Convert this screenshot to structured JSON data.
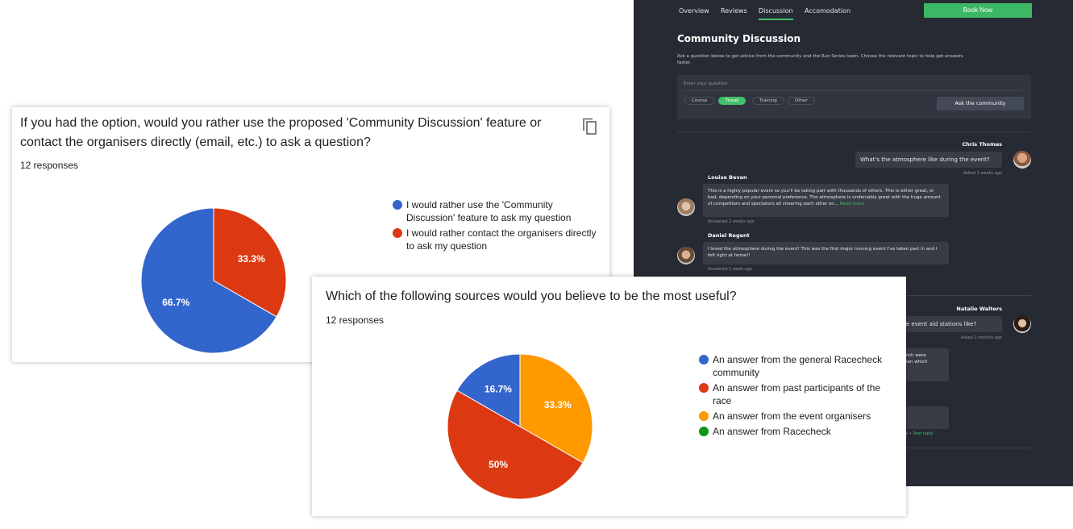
{
  "app": {
    "nav": {
      "tabs": [
        {
          "label": "Overview"
        },
        {
          "label": "Reviews"
        },
        {
          "label": "Discussion"
        },
        {
          "label": "Accomodation"
        }
      ],
      "book_label": "Book Now"
    },
    "title": "Community Discussion",
    "description": "Ask a question below to get advice from the community and the Run Series team. Choose the relevant topic to help get answers faster.",
    "ask": {
      "placeholder": "Enter your question",
      "topics": [
        "Course",
        "Travel",
        "Training",
        "Other"
      ],
      "active_topic": "Travel",
      "button_label": "Ask the community"
    },
    "threads": [
      {
        "asker": "Chris Thomas",
        "question": "What's the atmosphere like during the event?",
        "asked": "Asked 3 weeks ago",
        "answers": [
          {
            "name": "Louise Bevan",
            "text": "This is a highly popular event so you'll be taking part with thousands of others. This is either great, or bad, depending on your personal preference. The atmosphere is undeniably great with the huge amount of competitors and spectators all cheering each other on...",
            "read_more": "Read more",
            "meta": "Answered 2 weeks ago"
          },
          {
            "name": "Daniel Regent",
            "text": "I loved the atmosphere during the event! This was the first major running event I've taken part in and I felt right at home!!",
            "meta": "Answered 1 week ago"
          }
        ]
      },
      {
        "asker": "Natalie Walters",
        "question": "vere the event aid stations like?",
        "asked": "Asked 2 months ago",
        "answer_fragment": "hich were\ntion which",
        "footer_fragment": "el",
        "post_reply": "Post reply"
      }
    ]
  },
  "colors": {
    "blue": "#3366cc",
    "red": "#dc3912",
    "orange": "#ff9900",
    "green": "#109618",
    "accent": "#43c06b"
  },
  "chart_data": [
    {
      "type": "pie",
      "title": "If you had the option, would you rather use the proposed 'Community Discussion' feature or contact the organisers directly (email, etc.) to ask a question?",
      "responses": "12 responses",
      "slices": [
        {
          "label": "I would rather use the 'Community Discussion' feature to ask my question",
          "value": 66.7,
          "display": "66.7%",
          "color": "#3366cc"
        },
        {
          "label": "I would rather contact the organisers directly to ask my question",
          "value": 33.3,
          "display": "33.3%",
          "color": "#dc3912"
        }
      ]
    },
    {
      "type": "pie",
      "title": "Which of the following sources would you believe to be the most useful?",
      "responses": "12 responses",
      "slices": [
        {
          "label": "An answer from the general Racecheck community",
          "value": 16.7,
          "display": "16.7%",
          "color": "#3366cc"
        },
        {
          "label": "An answer from past participants of the race",
          "value": 50,
          "display": "50%",
          "color": "#dc3912"
        },
        {
          "label": "An answer from the event organisers",
          "value": 33.3,
          "display": "33.3%",
          "color": "#ff9900"
        },
        {
          "label": "An answer from Racecheck",
          "value": 0,
          "display": "",
          "color": "#109618"
        }
      ]
    }
  ]
}
